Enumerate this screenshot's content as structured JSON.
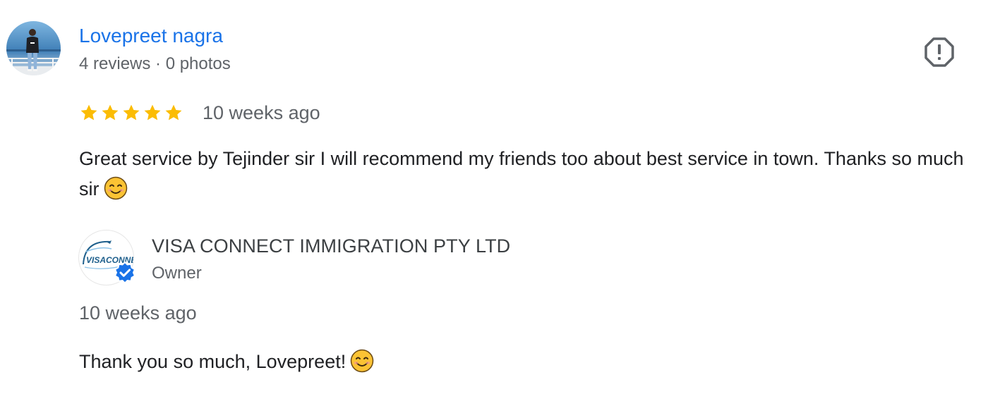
{
  "review": {
    "reviewer": {
      "name": "Lovepreet nagra",
      "meta": "4 reviews · 0 photos",
      "avatar_icon": "profile-photo"
    },
    "report_icon": "flag-report-icon",
    "rating": 5,
    "max_rating": 5,
    "date": "10 weeks ago",
    "text": "Great service by Tejinder sir I will recommend my friends too about best service in town. Thanks so much sir",
    "text_emoji": "smiling-face-emoji"
  },
  "owner_reply": {
    "name": "VISA CONNECT IMMIGRATION PTY LTD",
    "role": "Owner",
    "logo_icon": "visa-connect-logo",
    "logo_text": "VISACONNECT IMMIG",
    "verified_icon": "verified-badge-icon",
    "date": "10 weeks ago",
    "text": "Thank you so much, Lovepreet!",
    "text_emoji": "smiling-face-emoji"
  },
  "colors": {
    "link_blue": "#1a73e8",
    "star_gold": "#fbbc04",
    "text_primary": "#202124",
    "text_secondary": "#5f6368",
    "verified_blue": "#1a73e8"
  }
}
